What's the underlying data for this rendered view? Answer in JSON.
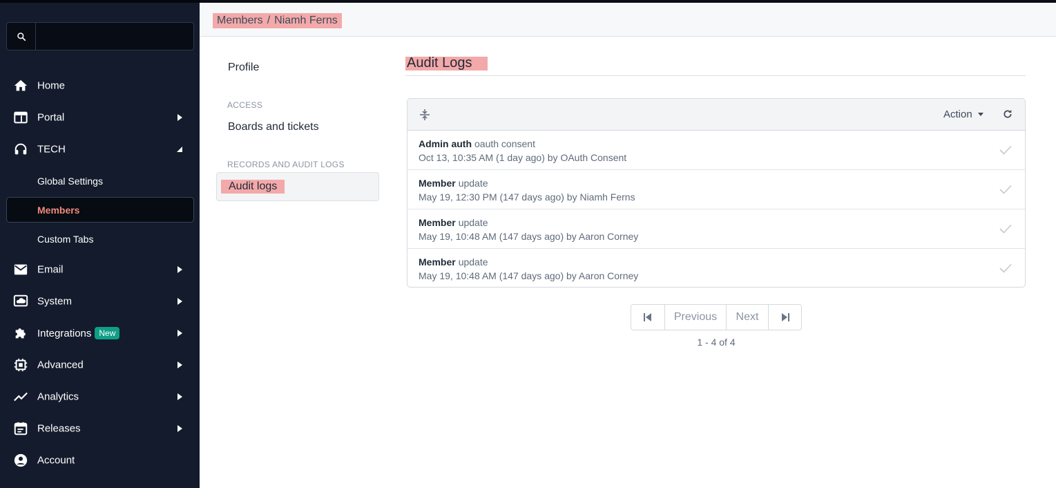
{
  "search": {
    "placeholder": "",
    "icon": "search-icon"
  },
  "sidebar": {
    "items": [
      {
        "label": "Home",
        "icon": "home-icon"
      },
      {
        "label": "Portal",
        "icon": "window-icon"
      },
      {
        "label": "TECH",
        "icon": "headset-icon"
      },
      {
        "label": "Email",
        "icon": "mail-icon"
      },
      {
        "label": "System",
        "icon": "cloud-icon"
      },
      {
        "label": "Integrations",
        "icon": "puzzle-icon",
        "badge": "New"
      },
      {
        "label": "Advanced",
        "icon": "chip-icon"
      },
      {
        "label": "Analytics",
        "icon": "trend-icon"
      },
      {
        "label": "Releases",
        "icon": "calendar-icon"
      },
      {
        "label": "Account",
        "icon": "account-icon"
      }
    ],
    "sub_items": [
      {
        "label": "Global Settings"
      },
      {
        "label": "Members",
        "active": true
      },
      {
        "label": "Custom Tabs"
      }
    ]
  },
  "breadcrumb": {
    "parent": "Members",
    "separator": "/",
    "current": "Niamh Ferns"
  },
  "menu": {
    "profile": "Profile",
    "access_heading": "ACCESS",
    "boards": "Boards and tickets",
    "records_heading": "RECORDS AND AUDIT LOGS",
    "audit": "Audit logs"
  },
  "main": {
    "title": "Audit Logs",
    "action_label": "Action",
    "rows": [
      {
        "subject": "Admin auth",
        "action": "oauth consent",
        "detail": "Oct 13, 10:35 AM (1 day ago) by OAuth Consent"
      },
      {
        "subject": "Member",
        "action": "update",
        "detail": "May 19, 12:30 PM (147 days ago) by Niamh Ferns"
      },
      {
        "subject": "Member",
        "action": "update",
        "detail": "May 19, 10:48 AM (147 days ago) by Aaron Corney"
      },
      {
        "subject": "Member",
        "action": "update",
        "detail": "May 19, 10:48 AM (147 days ago) by Aaron Corney"
      }
    ]
  },
  "pagination": {
    "previous": "Previous",
    "next": "Next",
    "range": "1 - 4 of 4"
  },
  "colors": {
    "sidebar_bg": "#131b2c",
    "active_text": "#f08a7a",
    "highlight": "#f3a9a9",
    "badge": "#0f9f86"
  }
}
